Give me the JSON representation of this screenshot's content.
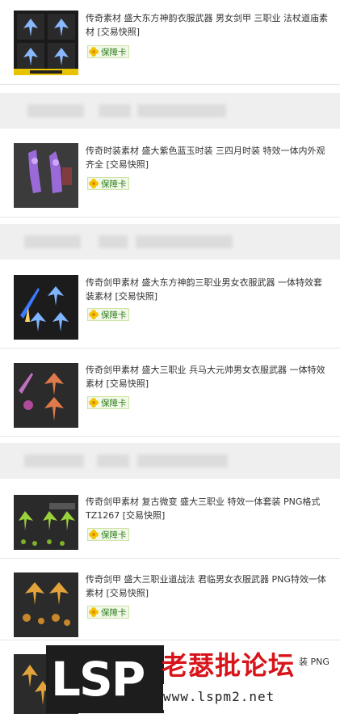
{
  "items": [
    {
      "title": "传奇素材 盛大东方神韵衣服武器 男女剑甲 三职业 法杖道庙素材 [交易快照]",
      "badge": "保障卡"
    },
    {
      "title": "传奇时装素材 盛大紫色蓝玉时装 三四月时装 特效一体内外观齐全 [交易快照]",
      "badge": "保障卡"
    },
    {
      "title": "传奇剑甲素材 盛大东方神韵三职业男女衣服武器 一体特效套装素材 [交易快照]",
      "badge": "保障卡"
    },
    {
      "title": "传奇剑甲素材 盛大三职业 兵马大元帅男女衣服武器 一体特效素材 [交易快照]",
      "badge": "保障卡"
    },
    {
      "title": "传奇剑甲素材 复古微变 盛大三职业 特效一体套装 PNG格式 TZ1267 [交易快照]",
      "badge": "保障卡"
    },
    {
      "title": "传奇剑甲 盛大三职业道战法 君临男女衣服武器 PNG特效一体素材 [交易快照]",
      "badge": "保障卡"
    },
    {
      "title": "装 PNG",
      "badge": ""
    }
  ],
  "watermark": {
    "brand": "LSP",
    "chinese": "老瑟批论坛",
    "url": "www.lspm2.net"
  },
  "colors": {
    "badge_text": "#2c7c1b",
    "watermark_red": "#d8141a"
  }
}
